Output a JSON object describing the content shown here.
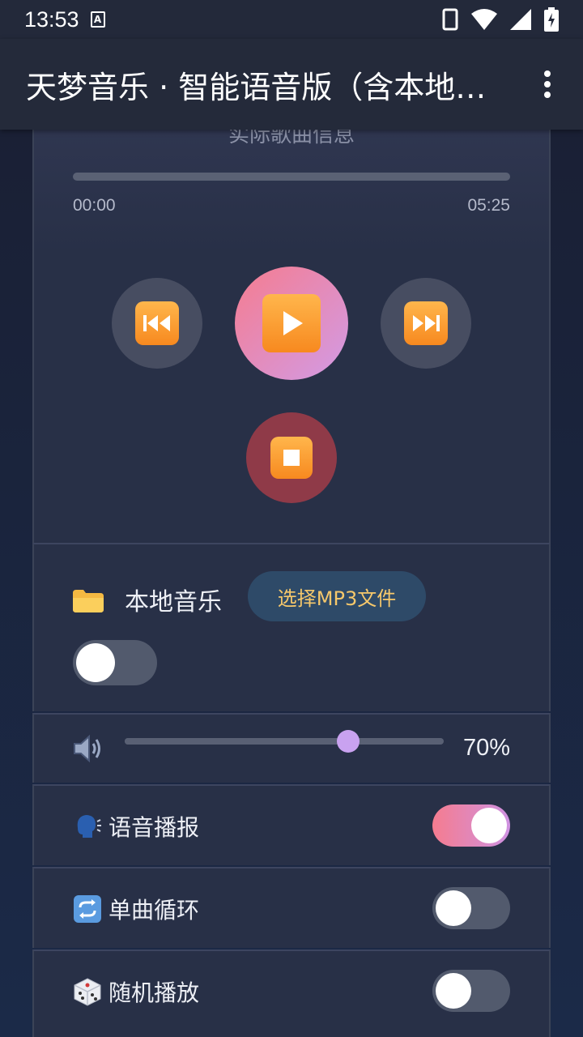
{
  "status_bar": {
    "time": "13:53",
    "notification_icon": "A",
    "icons": [
      "phone-outline-icon",
      "wifi-icon",
      "signal-icon",
      "battery-charging-icon"
    ]
  },
  "app_bar": {
    "title": "天梦音乐 · 智能语音版（含本地…",
    "menu_icon": "more-vert-icon"
  },
  "player": {
    "cut_text": "实际歌曲信息",
    "progress_fraction": 0,
    "current_time": "00:00",
    "total_time": "05:25",
    "prev_icon": "⏮",
    "play_icon": "▶",
    "next_icon": "⏭",
    "stop_icon": "⏹"
  },
  "local_music": {
    "icon": "📁",
    "label": "本地音乐",
    "select_button": "选择MP3文件",
    "enabled": false
  },
  "volume": {
    "icon": "🔊",
    "value_percent": 70,
    "label": "70%"
  },
  "toggles": [
    {
      "icon": "🗣️",
      "label": "语音播报",
      "on": true
    },
    {
      "icon": "🔄",
      "label": "单曲循环",
      "on": false
    },
    {
      "icon": "🎲",
      "label": "随机播放",
      "on": false
    }
  ],
  "colors": {
    "accent_gradient_start": "#f57c8f",
    "accent_gradient_end": "#d29be6",
    "button_text": "#f6c86b",
    "panel": "#283047"
  }
}
